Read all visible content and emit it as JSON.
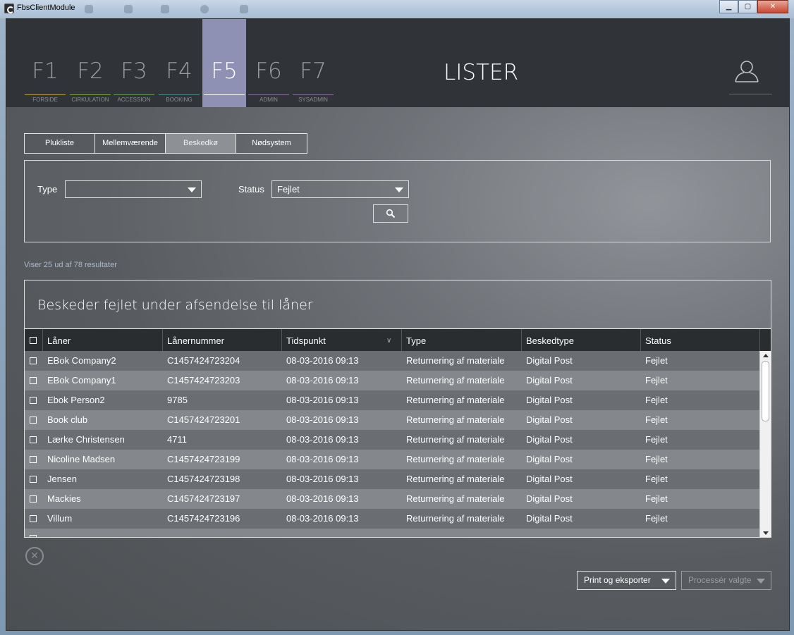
{
  "window": {
    "title": "FbsClientModule"
  },
  "nav": {
    "keys": [
      {
        "key": "F1",
        "label": "FORSIDE",
        "color": "#b8a045"
      },
      {
        "key": "F2",
        "label": "CIRKULATION",
        "color": "#7fa845"
      },
      {
        "key": "F3",
        "label": "ACCESSION",
        "color": "#6a9a5e"
      },
      {
        "key": "F4",
        "label": "BOOKING",
        "color": "#4f8a8c"
      },
      {
        "key": "F5",
        "label": "",
        "color": "#ffffff"
      },
      {
        "key": "F6",
        "label": "ADMIN",
        "color": "#8a6e9a"
      },
      {
        "key": "F7",
        "label": "SYSADMIN",
        "color": "#8a6e9a"
      }
    ],
    "active": "F5"
  },
  "page": {
    "heading": "LISTER"
  },
  "tabs": [
    {
      "label": "Plukliste"
    },
    {
      "label": "Mellemværende"
    },
    {
      "label": "Beskedkø"
    },
    {
      "label": "Nødsystem"
    }
  ],
  "filter": {
    "type_label": "Type",
    "type_value": "",
    "status_label": "Status",
    "status_value": "Fejlet"
  },
  "results": {
    "summary": "Viser 25 ud af 78 resultater"
  },
  "table": {
    "title": "Beskeder fejlet under afsendelse til låner",
    "columns": [
      "Låner",
      "Lånernummer",
      "Tidspunkt",
      "Type",
      "Beskedtype",
      "Status"
    ],
    "sort_indicator": "∨",
    "rows": [
      [
        "EBok Company2",
        "C1457424723204",
        "08-03-2016 09:13",
        "Returnering af materiale",
        "Digital Post",
        "Fejlet"
      ],
      [
        "EBok Company1",
        "C1457424723203",
        "08-03-2016 09:13",
        "Returnering af materiale",
        "Digital Post",
        "Fejlet"
      ],
      [
        "Ebok Person2",
        "9785",
        "08-03-2016 09:13",
        "Returnering af materiale",
        "Digital Post",
        "Fejlet"
      ],
      [
        "Book club",
        "C1457424723201",
        "08-03-2016 09:13",
        "Returnering af materiale",
        "Digital Post",
        "Fejlet"
      ],
      [
        "Lærke Christensen",
        "4711",
        "08-03-2016 09:13",
        "Returnering af materiale",
        "Digital Post",
        "Fejlet"
      ],
      [
        "Nicoline Madsen",
        "C1457424723199",
        "08-03-2016 09:13",
        "Returnering af materiale",
        "Digital Post",
        "Fejlet"
      ],
      [
        "Jensen",
        "C1457424723198",
        "08-03-2016 09:13",
        "Returnering af materiale",
        "Digital Post",
        "Fejlet"
      ],
      [
        "Mackies",
        "C1457424723197",
        "08-03-2016 09:13",
        "Returnering af materiale",
        "Digital Post",
        "Fejlet"
      ],
      [
        "Villum",
        "C1457424723196",
        "08-03-2016 09:13",
        "Returnering af materiale",
        "Digital Post",
        "Fejlet"
      ]
    ]
  },
  "actions": {
    "print_label": "Print og eksporter",
    "process_label": "Processér valgte"
  }
}
